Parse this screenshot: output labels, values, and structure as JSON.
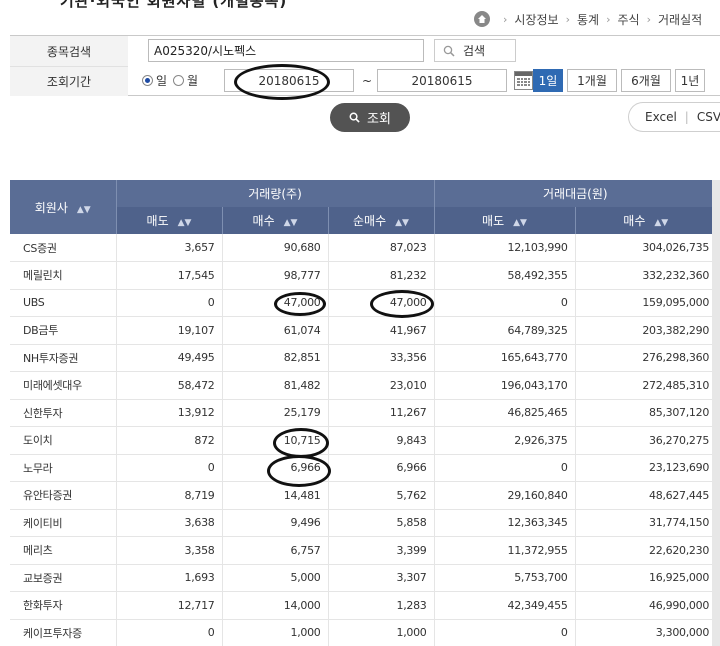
{
  "header": {
    "page_title_cut": "기관·외국인 회원사별 (개별종목)"
  },
  "breadcrumb": {
    "items": [
      "시장정보",
      "통계",
      "주식",
      "거래실적"
    ]
  },
  "search": {
    "stock_label": "종목검색",
    "stock_value": "A025320/시노펙스",
    "search_button": "검색",
    "period_label": "조회기간",
    "radio_day": "일",
    "radio_month": "월",
    "start_date": "20180615",
    "end_date": "20180615",
    "tilde": "~",
    "period_buttons": [
      "1일",
      "1개월",
      "6개월",
      "1년"
    ],
    "active_period": "1일",
    "query_button": "조회",
    "excel": "Excel",
    "csv": "CSV"
  },
  "table": {
    "col_member": "회원사",
    "group_volume": "거래량(주)",
    "group_amount": "거래대금(원)",
    "sub_sell": "매도",
    "sub_buy": "매수",
    "sub_net": "순매수",
    "rows": [
      {
        "name": "CS증권",
        "v_sell": "3,657",
        "v_buy": "90,680",
        "v_net": "87,023",
        "a_sell": "12,103,990",
        "a_buy": "304,026,735"
      },
      {
        "name": "메릴린치",
        "v_sell": "17,545",
        "v_buy": "98,777",
        "v_net": "81,232",
        "a_sell": "58,492,355",
        "a_buy": "332,232,360"
      },
      {
        "name": "UBS",
        "v_sell": "0",
        "v_buy": "47,000",
        "v_net": "47,000",
        "a_sell": "0",
        "a_buy": "159,095,000"
      },
      {
        "name": "DB금투",
        "v_sell": "19,107",
        "v_buy": "61,074",
        "v_net": "41,967",
        "a_sell": "64,789,325",
        "a_buy": "203,382,290"
      },
      {
        "name": "NH투자증권",
        "v_sell": "49,495",
        "v_buy": "82,851",
        "v_net": "33,356",
        "a_sell": "165,643,770",
        "a_buy": "276,298,360"
      },
      {
        "name": "미래에셋대우",
        "v_sell": "58,472",
        "v_buy": "81,482",
        "v_net": "23,010",
        "a_sell": "196,043,170",
        "a_buy": "272,485,310"
      },
      {
        "name": "신한투자",
        "v_sell": "13,912",
        "v_buy": "25,179",
        "v_net": "11,267",
        "a_sell": "46,825,465",
        "a_buy": "85,307,120"
      },
      {
        "name": "도이치",
        "v_sell": "872",
        "v_buy": "10,715",
        "v_net": "9,843",
        "a_sell": "2,926,375",
        "a_buy": "36,270,275"
      },
      {
        "name": "노무라",
        "v_sell": "0",
        "v_buy": "6,966",
        "v_net": "6,966",
        "a_sell": "0",
        "a_buy": "23,123,690"
      },
      {
        "name": "유안타증권",
        "v_sell": "8,719",
        "v_buy": "14,481",
        "v_net": "5,762",
        "a_sell": "29,160,840",
        "a_buy": "48,627,445"
      },
      {
        "name": "케이티비",
        "v_sell": "3,638",
        "v_buy": "9,496",
        "v_net": "5,858",
        "a_sell": "12,363,345",
        "a_buy": "31,774,150"
      },
      {
        "name": "메리츠",
        "v_sell": "3,358",
        "v_buy": "6,757",
        "v_net": "3,399",
        "a_sell": "11,372,955",
        "a_buy": "22,620,230"
      },
      {
        "name": "교보증권",
        "v_sell": "1,693",
        "v_buy": "5,000",
        "v_net": "3,307",
        "a_sell": "5,753,700",
        "a_buy": "16,925,000"
      },
      {
        "name": "한화투자",
        "v_sell": "12,717",
        "v_buy": "14,000",
        "v_net": "1,283",
        "a_sell": "42,349,455",
        "a_buy": "46,990,000"
      },
      {
        "name": "케이프투자증",
        "v_sell": "0",
        "v_buy": "1,000",
        "v_net": "1,000",
        "a_sell": "0",
        "a_buy": "3,300,000"
      }
    ]
  }
}
